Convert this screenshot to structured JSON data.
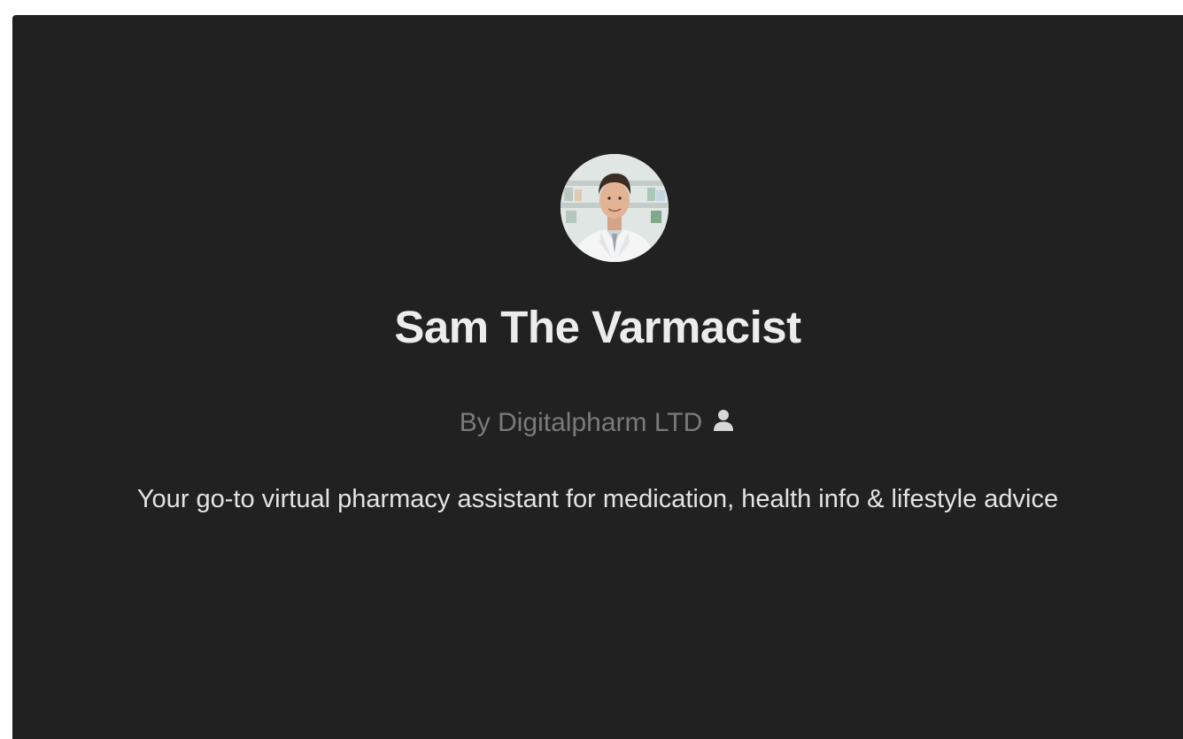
{
  "gpt": {
    "name": "Sam The Varmacist",
    "byline": "By Digitalpharm LTD",
    "description": "Your go-to virtual pharmacy assistant for medication, health info & lifestyle advice",
    "avatar_icon": "pharmacist-avatar",
    "author_icon": "user-icon"
  },
  "colors": {
    "panel_background": "#212121",
    "title": "#ececec",
    "byline": "#7a7a7a",
    "description": "#e3e3e3"
  }
}
